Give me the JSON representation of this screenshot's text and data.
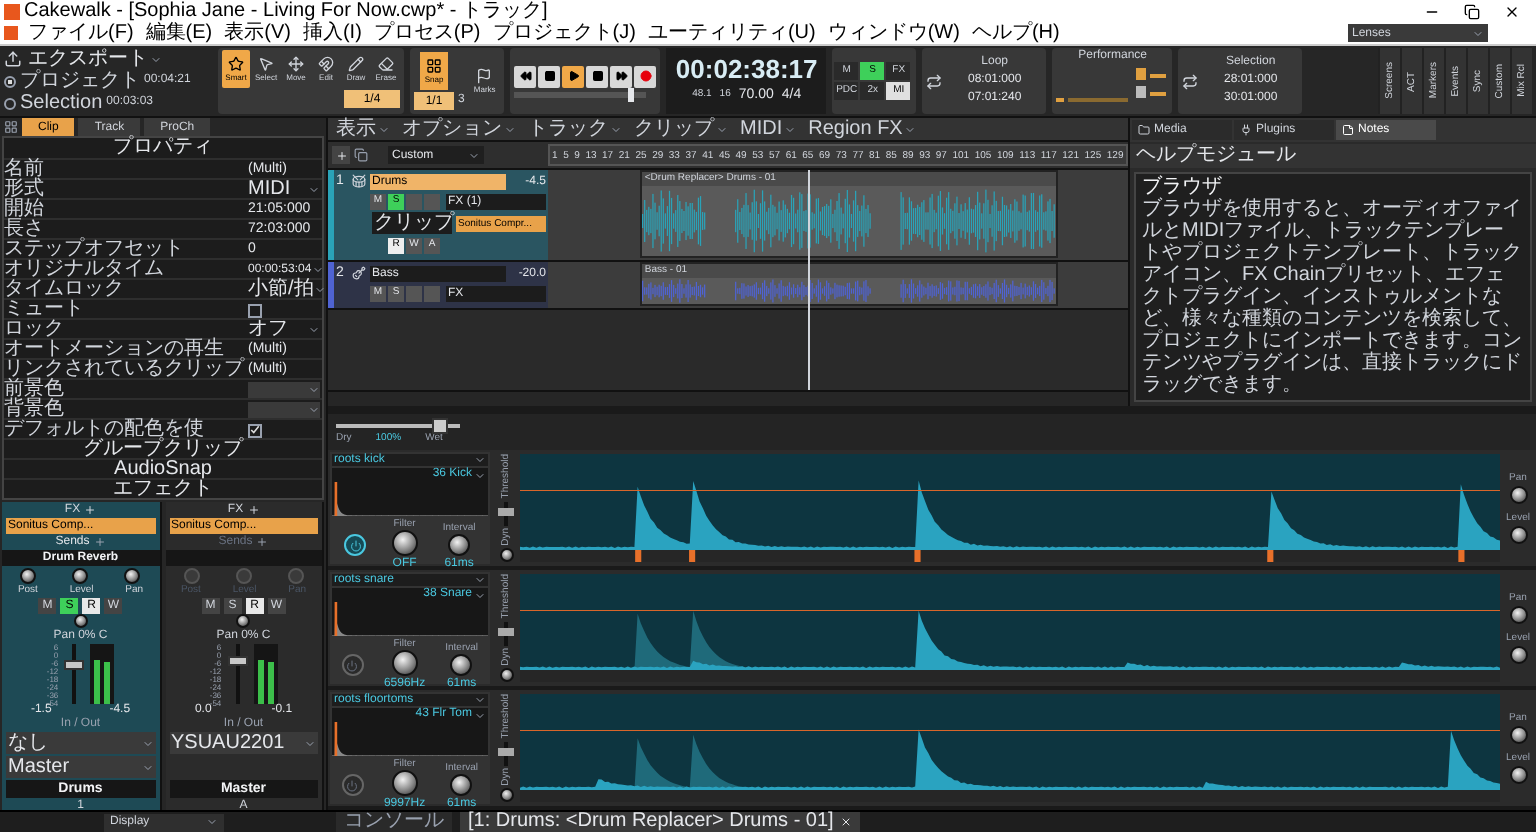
{
  "window": {
    "title": "Cakewalk - [Sophia Jane - Living For Now.cwp* - トラック]"
  },
  "menu": [
    "ファイル(F)",
    "編集(E)",
    "表示(V)",
    "挿入(I)",
    "プロセス(P)",
    "プロジェクト(J)",
    "ユーティリティ(U)",
    "ウィンドウ(W)",
    "ヘルプ(H)"
  ],
  "lens": "Lenses",
  "toolbar": {
    "export": {
      "label": "エクスポート",
      "options": [
        {
          "label": "プロジェクト",
          "time": "00:04:21",
          "selected": true
        },
        {
          "label": "Selection",
          "time": "00:03:03",
          "selected": false
        }
      ]
    },
    "tools": [
      {
        "label": "Smart",
        "selected": true
      },
      {
        "label": "Select",
        "selected": false
      },
      {
        "label": "Move",
        "selected": false
      },
      {
        "label": "Edit",
        "selected": false
      },
      {
        "label": "Draw",
        "selected": false
      },
      {
        "label": "Erase",
        "selected": false
      }
    ],
    "tool_resolution": "1/4",
    "snap": {
      "label": "Snap",
      "on": true,
      "value": "1/1",
      "count": "3",
      "marks": "Marks"
    },
    "transport": [
      {
        "kind": "rewind",
        "active": false
      },
      {
        "kind": "stop",
        "active": false
      },
      {
        "kind": "play",
        "active": true
      },
      {
        "kind": "square",
        "active": false
      },
      {
        "kind": "forward",
        "active": false
      },
      {
        "kind": "record",
        "active": false
      }
    ],
    "position_slider": {
      "level": 0.9
    },
    "position": "00:02:38:17",
    "sample_rate": "48.1",
    "bit_depth": "16",
    "tempo": "70.00",
    "meter": "4/4",
    "track_buttons": [
      {
        "kind": "mute",
        "label": "M",
        "on": false
      },
      {
        "kind": "solo",
        "label": "S",
        "on": true
      },
      {
        "kind": "fx",
        "label": "FX",
        "on": false
      },
      {
        "kind": "pdc",
        "label": "PDC",
        "on": false
      },
      {
        "kind": "speed",
        "label": "2x",
        "on": false
      },
      {
        "kind": "midi",
        "label": "MI",
        "on": true
      }
    ],
    "loop": {
      "title": "Loop",
      "start": "08:01:000",
      "end": "07:01:240"
    },
    "performance": {
      "title": "Performance"
    },
    "selection": {
      "title": "Selection",
      "start": "28:01:000",
      "end": "30:01:000"
    },
    "views": [
      "Screens",
      "ACT",
      "Markers",
      "Events",
      "Sync",
      "Custom",
      "Mix Rcl"
    ]
  },
  "inspector": {
    "tabs": [
      {
        "label": "Clip",
        "selected": true
      },
      {
        "label": "Track",
        "selected": false
      },
      {
        "label": "ProCh",
        "selected": false
      }
    ],
    "title": "プロパティ",
    "properties": [
      {
        "kind": "text",
        "label": "名前",
        "value": "(Multi)"
      },
      {
        "kind": "dropdown",
        "label": "形式",
        "value": "MIDI"
      },
      {
        "kind": "text",
        "label": "開始",
        "value": "21:05:000"
      },
      {
        "kind": "text",
        "label": "長さ",
        "value": "72:03:000"
      },
      {
        "kind": "text",
        "label": "ステップオフセット",
        "value": "0"
      },
      {
        "kind": "time",
        "label": "オリジナルタイム",
        "value": "00:00:53:04"
      },
      {
        "kind": "dropdown",
        "label": "タイムロック",
        "value": "小節/拍"
      },
      {
        "kind": "check",
        "label": "ミュート",
        "checked": false
      },
      {
        "kind": "dropdown",
        "label": "ロック",
        "value": "オフ"
      },
      {
        "kind": "text",
        "label": "オートメーションの再生",
        "value": "(Multi)"
      },
      {
        "kind": "text",
        "label": "リンクされているクリップ",
        "value": "(Multi)"
      },
      {
        "kind": "swatch",
        "label": "前景色"
      },
      {
        "kind": "swatch",
        "label": "背景色"
      },
      {
        "kind": "check",
        "label": "デフォルトの配色を使",
        "checked": true
      }
    ],
    "actions": [
      "グループクリップ",
      "AudioSnap",
      "エフェクト"
    ]
  },
  "channels": [
    {
      "fx": "FX",
      "plugin": "Sonitus Comp...",
      "sends": "Sends",
      "send_name": "Drum Reverb",
      "sends_enabled": true,
      "knobs": [
        "Post",
        "Level",
        "Pan"
      ],
      "buttons": [
        {
          "kind": "mute",
          "label": "M",
          "on": false
        },
        {
          "kind": "solo",
          "label": "S",
          "on": true
        },
        {
          "kind": "read",
          "label": "R",
          "on": true
        },
        {
          "kind": "write",
          "label": "W",
          "on": false
        }
      ],
      "pan": "Pan 0% C",
      "scale": [
        "6",
        "0",
        "-6",
        "-12",
        "-18",
        "-24",
        "-36",
        "-54"
      ],
      "level": 0.7,
      "readings": [
        "-1.5",
        "-4.5"
      ],
      "io": "In / Out",
      "routes": [
        "なし",
        "Master"
      ],
      "name": "Drums",
      "number": "1",
      "selected": true
    },
    {
      "fx": "FX",
      "plugin": "Sonitus Comp...",
      "sends": "Sends",
      "sends_enabled": false,
      "knobs": [
        "Post",
        "Level",
        "Pan"
      ],
      "buttons": [
        {
          "kind": "mute",
          "label": "M",
          "on": false
        },
        {
          "kind": "solo",
          "label": "S",
          "on": false
        },
        {
          "kind": "read",
          "label": "R",
          "on": true
        },
        {
          "kind": "write",
          "label": "W",
          "on": false
        }
      ],
      "pan": "Pan 0% C",
      "scale": [
        "6",
        "0",
        "-6",
        "-12",
        "-18",
        "-24",
        "-36",
        "-54"
      ],
      "level": 0.75,
      "readings": [
        "0.0",
        "-0.1"
      ],
      "io": "In / Out",
      "routes": [
        "YSUAU2201"
      ],
      "name": "Master",
      "number": "A",
      "selected": false
    }
  ],
  "display": "Display",
  "trackview": {
    "menus": [
      "表示",
      "オプション",
      "トラック",
      "クリップ",
      "MIDI",
      "Region FX"
    ],
    "preset": "Custom",
    "ruler": [
      "1",
      "5",
      "9",
      "13",
      "17",
      "21",
      "25",
      "29",
      "33",
      "37",
      "41",
      "45",
      "49",
      "53",
      "57",
      "61",
      "65",
      "69",
      "73",
      "77",
      "81",
      "85",
      "89",
      "93",
      "97",
      "101",
      "105",
      "109",
      "113",
      "117",
      "121",
      "125",
      "129"
    ],
    "tracks": [
      {
        "number": "1",
        "name": "Drums",
        "volume": "-4.5",
        "selected": true,
        "color": "#2aa3b8",
        "fx": "FX (1)",
        "plugin": "Sonitus Compr...",
        "view": "クリップ",
        "clip": "<Drum Replacer> Drums - 01",
        "buttons": [
          {
            "kind": "mute",
            "label": "M",
            "on": false
          },
          {
            "kind": "solo",
            "label": "S",
            "on": true
          },
          {
            "kind": "arm",
            "on": false
          },
          {
            "kind": "echo",
            "on": false
          }
        ],
        "automation": [
          {
            "kind": "read",
            "label": "R",
            "on": true
          },
          {
            "kind": "write",
            "label": "W",
            "on": false
          },
          {
            "kind": "arm",
            "label": "A",
            "on": false
          }
        ]
      },
      {
        "number": "2",
        "name": "Bass",
        "volume": "-20.0",
        "selected": false,
        "color": "#4f63d2",
        "fx": "FX",
        "clip": "Bass - 01",
        "buttons": [
          {
            "kind": "mute",
            "label": "M",
            "on": false
          },
          {
            "kind": "solo",
            "label": "S",
            "on": false
          },
          {
            "kind": "arm",
            "on": false
          },
          {
            "kind": "echo",
            "on": false
          }
        ]
      }
    ]
  },
  "browser": {
    "tabs": [
      {
        "label": "Media",
        "selected": false
      },
      {
        "label": "Plugins",
        "selected": false
      },
      {
        "label": "Notes",
        "selected": true
      }
    ],
    "module": "ヘルプモジュール",
    "title": "ブラウザ",
    "text": "ブラウザを使用すると、オーディオファイルとMIDIファイル、トラックテンプレートやプロジェクトテンプレート、トラックアイコン、FX Chainプリセット、エフェクトプラグイン、インストゥルメントなど、様々な種類のコンテンツを検索して、プロジェクトにインポートできます。コンテンツやプラグインは、直接トラックにドラッグできます。"
  },
  "drum_replacer": {
    "dry": "Dry",
    "mix": "100%",
    "wet": "Wet",
    "level": 0.85,
    "lanes": [
      {
        "name": "roots kick",
        "note": "36 Kick",
        "enabled": true,
        "threshold": {
          "level": 0.62
        },
        "filter_label": "Filter",
        "filter": "OFF",
        "interval_label": "Interval",
        "interval": "61ms",
        "threshold_label": "Threshold",
        "dyn_label": "Dyn",
        "pan_label": "Pan",
        "level_label": "Level"
      },
      {
        "name": "roots snare",
        "note": "38 Snare",
        "enabled": false,
        "threshold": {
          "level": 0.62
        },
        "filter_label": "Filter",
        "filter": "6596Hz",
        "interval_label": "Interval",
        "interval": "61ms",
        "threshold_label": "Threshold",
        "dyn_label": "Dyn",
        "pan_label": "Pan",
        "level_label": "Level"
      },
      {
        "name": "roots floortoms",
        "note": "43 Flr Tom",
        "enabled": false,
        "threshold": {
          "level": 0.62
        },
        "filter_label": "Filter",
        "filter": "9997Hz",
        "interval_label": "Interval",
        "interval": "61ms",
        "threshold_label": "Threshold",
        "dyn_label": "Dyn",
        "pan_label": "Pan",
        "level_label": "Level"
      }
    ]
  },
  "bottom_tabs": [
    {
      "label": "コンソール",
      "selected": false
    },
    {
      "label": "[1: Drums: <Drum Replacer> Drums - 01]",
      "selected": true
    }
  ]
}
